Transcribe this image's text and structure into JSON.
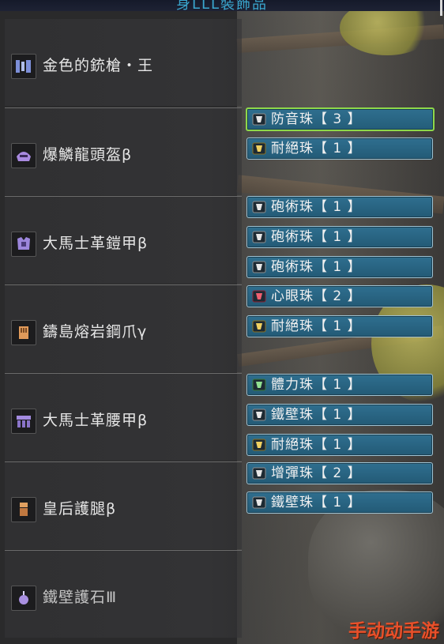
{
  "header": {
    "title": "身LLL裝飾品"
  },
  "equipment": [
    {
      "id": "weapon",
      "name": "金色的銃槍・王",
      "icon": "gunlance-icon",
      "decorations": []
    },
    {
      "id": "head",
      "name": "爆鱗龍頭盔β",
      "icon": "helm-icon",
      "decorations": [
        {
          "name": "防音珠【 3 】",
          "gem": "silver-gem-3",
          "active": true
        },
        {
          "name": "耐絕珠【 1 】",
          "gem": "gold-gem-1",
          "active": false
        }
      ]
    },
    {
      "id": "chest",
      "name": "大馬士革鎧甲β",
      "icon": "chest-armor-icon",
      "decorations": [
        {
          "name": "砲術珠【 1 】",
          "gem": "silver-gem-1",
          "active": false
        },
        {
          "name": "砲術珠【 1 】",
          "gem": "silver-gem-1",
          "active": false
        },
        {
          "name": "砲術珠【 1 】",
          "gem": "silver-gem-1",
          "active": false
        }
      ]
    },
    {
      "id": "arms",
      "name": "鑄島熔岩鋼爪γ",
      "icon": "gauntlet-icon",
      "decorations": [
        {
          "name": "心眼珠【 2 】",
          "gem": "red-gem-2",
          "active": false
        },
        {
          "name": "耐絕珠【 1 】",
          "gem": "gold-gem-1",
          "active": false
        }
      ]
    },
    {
      "id": "waist",
      "name": "大馬士革腰甲β",
      "icon": "waist-armor-icon",
      "decorations": [
        {
          "name": "體力珠【 1 】",
          "gem": "green-gem-1",
          "active": false
        },
        {
          "name": "鐵壁珠【 1 】",
          "gem": "silver-gem-1",
          "active": false
        },
        {
          "name": "耐絕珠【 1 】",
          "gem": "gold-gem-1",
          "active": false
        }
      ]
    },
    {
      "id": "legs",
      "name": "皇后護腿β",
      "icon": "leg-armor-icon",
      "decorations": [
        {
          "name": "增彈珠【 2 】",
          "gem": "silver-gem-2",
          "active": false
        },
        {
          "name": "鐵壁珠【 1 】",
          "gem": "silver-gem-2",
          "active": false
        }
      ]
    },
    {
      "id": "charm",
      "name": "鐵壁護石Ⅲ",
      "icon": "charm-icon",
      "decorations": []
    }
  ],
  "colors": {
    "slot_fill": "#2a6685",
    "slot_border": "#9fc3d3",
    "active_border": "#8ed84a",
    "title": "#3aa7cf",
    "watermark": "#e8502a"
  },
  "watermark": "手动动手游"
}
